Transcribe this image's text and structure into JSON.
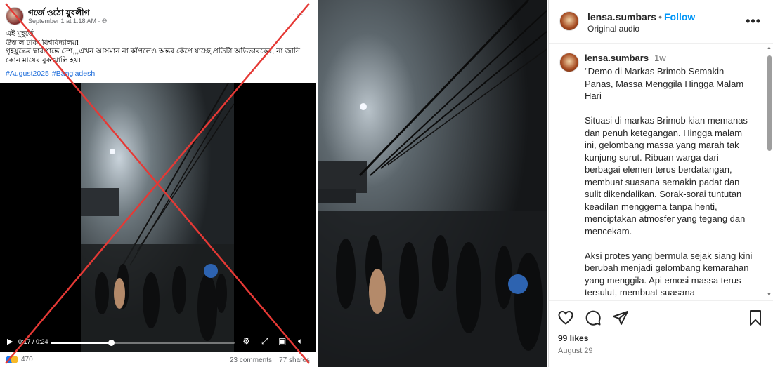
{
  "facebook": {
    "page_name": "গর্জে ওঠো যুবলীগ",
    "meta": "September 1 at 1:18 AM · ",
    "post_lines": [
      "এই মুহূর্তে",
      "উত্তাল ঢাকা বিশ্ববিদ্যালয়!",
      "গৃহযুদ্ধের দ্বারপ্রান্তে দেশ,,,এখন আসমান না কাঁপলেও অন্তর কেঁপে যাচ্ছে প্রতিটা অভিভাবকের, না জানি",
      "কোন মায়ের বুক খালি হয়।"
    ],
    "hashtags": [
      "#August2025",
      "#Bangladesh"
    ],
    "video": {
      "time": "0:17 / 0:24",
      "progress": 0.33
    },
    "reactions_count": "470",
    "comments": "23 comments",
    "shares": "77 shares",
    "more_icon": "more-horizontal-icon"
  },
  "instagram": {
    "username": "lensa.sumbars",
    "follow_label": "Follow",
    "audio": "Original audio",
    "caption_user": "lensa.sumbars",
    "caption_age": "1w",
    "caption_paragraphs": [
      "\"Demo di Markas Brimob Semakin Panas, Massa Menggila Hingga Malam Hari",
      "Situasi di markas Brimob kian memanas dan penuh ketegangan. Hingga malam ini, gelombang massa yang marah tak kunjung surut. Ribuan warga dari berbagai elemen terus berdatangan, membuat suasana semakin padat dan sulit dikendalikan. Sorak-sorai tuntutan keadilan menggema tanpa henti, menciptakan atmosfer yang tegang dan mencekam.",
      "Aksi protes yang bermula sejak siang kini berubah menjadi gelombang kemarahan yang menggila. Api emosi massa terus tersulut, membuat suasana"
    ],
    "likes": "99 likes",
    "date": "August 29",
    "icons": [
      "heart-icon",
      "comment-icon",
      "share-icon",
      "bookmark-icon"
    ]
  },
  "colors": {
    "fb_link": "#216fdb",
    "ig_follow": "#0095f6",
    "cross": "#e53935"
  }
}
